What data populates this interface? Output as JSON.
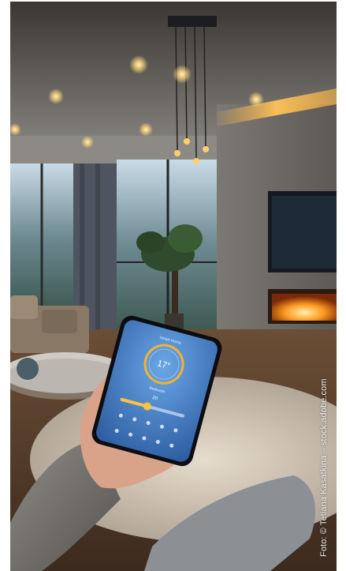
{
  "credit": "Foto: © Tetiana Kasatkina – stock.adobe.com",
  "phone": {
    "header": "Smart Home",
    "temperature": "17°",
    "caption": "Bedroom",
    "setpoint": "20",
    "level": 0.42
  },
  "colors": {
    "accent": "#ffc23a",
    "ring": "#f2b230",
    "screen": "#4f8fd6",
    "fireplace": "#ff8a1c"
  }
}
